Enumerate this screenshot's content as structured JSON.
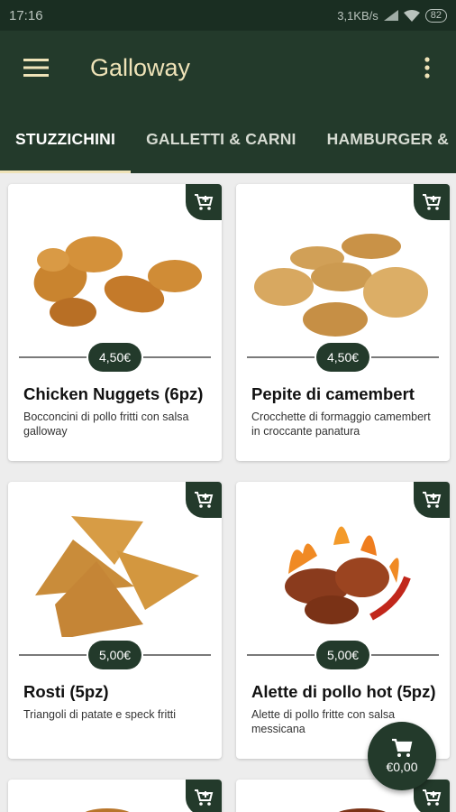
{
  "status_bar": {
    "time": "17:16",
    "network_speed": "3,1KB/s",
    "battery": "82"
  },
  "app_bar": {
    "title": "Galloway",
    "menu_icon": "hamburger-menu-icon",
    "more_icon": "more-vert-icon"
  },
  "tabs": [
    {
      "label": "STUZZICHINI",
      "active": true
    },
    {
      "label": "GALLETTI & CARNI",
      "active": false
    },
    {
      "label": "HAMBURGER &",
      "active": false
    }
  ],
  "products": [
    {
      "name": "Chicken Nuggets (6pz)",
      "price": "4,50€",
      "description": "Bocconcini di pollo fritti con salsa galloway"
    },
    {
      "name": "Pepite di camembert",
      "price": "4,50€",
      "description": "Crocchette di formaggio camembert in croccante panatura"
    },
    {
      "name": "Rosti (5pz)",
      "price": "5,00€",
      "description": "Triangoli di patate e speck fritti"
    },
    {
      "name": "Alette di pollo hot (5pz)",
      "price": "5,00€",
      "description": "Alette di pollo fritte con salsa messicana"
    }
  ],
  "cart": {
    "total": "€0,00",
    "icon": "cart-icon"
  },
  "colors": {
    "primary": "#233a2b",
    "status_bar": "#1a2e22",
    "title_text": "#efe3b8",
    "background": "#ededed"
  }
}
